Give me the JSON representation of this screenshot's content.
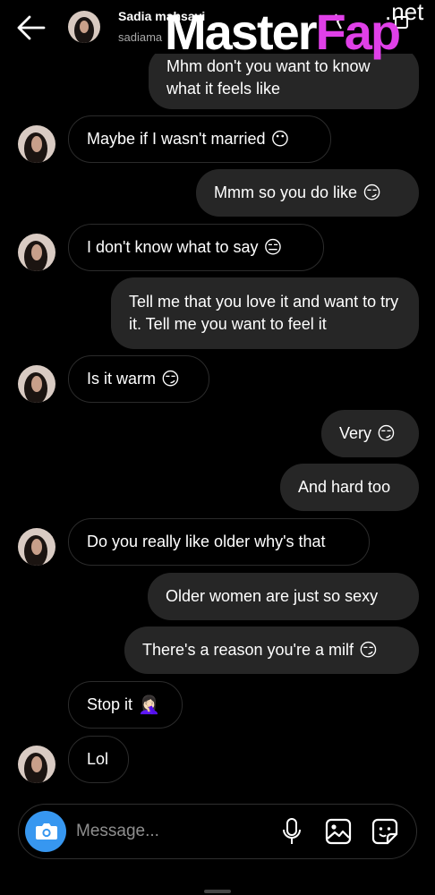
{
  "header": {
    "name": "Sadia mahsavi",
    "username": "sadiama"
  },
  "watermark": {
    "white": "Master",
    "pink": "Fap",
    "suffix": ".net"
  },
  "messages": [
    {
      "side": "sent",
      "text": "Mhm don't you want to know what it feels like",
      "emoji": ""
    },
    {
      "side": "received",
      "text": "Maybe if I wasn't married",
      "emoji": "😶"
    },
    {
      "side": "sent",
      "text": "Mmm so you do like",
      "emoji": "😏"
    },
    {
      "side": "received",
      "text": "I don't know what to say",
      "emoji": "😑"
    },
    {
      "side": "sent",
      "text": "Tell me that you love it and want to try it. Tell me you want to feel it",
      "emoji": ""
    },
    {
      "side": "received",
      "text": "Is it warm",
      "emoji": "😏"
    },
    {
      "side": "sent",
      "text": "Very",
      "emoji": "😏"
    },
    {
      "side": "sent",
      "text": "And hard too",
      "emoji": ""
    },
    {
      "side": "received",
      "text": "Do you really like older why's that",
      "emoji": ""
    },
    {
      "side": "sent",
      "text": "Older women are just so sexy",
      "emoji": ""
    },
    {
      "side": "sent",
      "text": "There's a reason you're a milf",
      "emoji": "😏"
    },
    {
      "side": "received",
      "text": "Stop it",
      "emoji": "🤦🏻‍♀️"
    },
    {
      "side": "received",
      "text": "Lol",
      "emoji": ""
    }
  ],
  "composer": {
    "placeholder": "Message..."
  },
  "colors": {
    "background": "#000000",
    "sent_bubble": "#262626",
    "received_border": "#2b2b2b",
    "camera_button": "#3797f0",
    "watermark_pink": "#e040e8"
  },
  "icons": [
    "back-arrow-icon",
    "avatar",
    "camera-icon",
    "microphone-icon",
    "gallery-icon",
    "sticker-icon"
  ]
}
